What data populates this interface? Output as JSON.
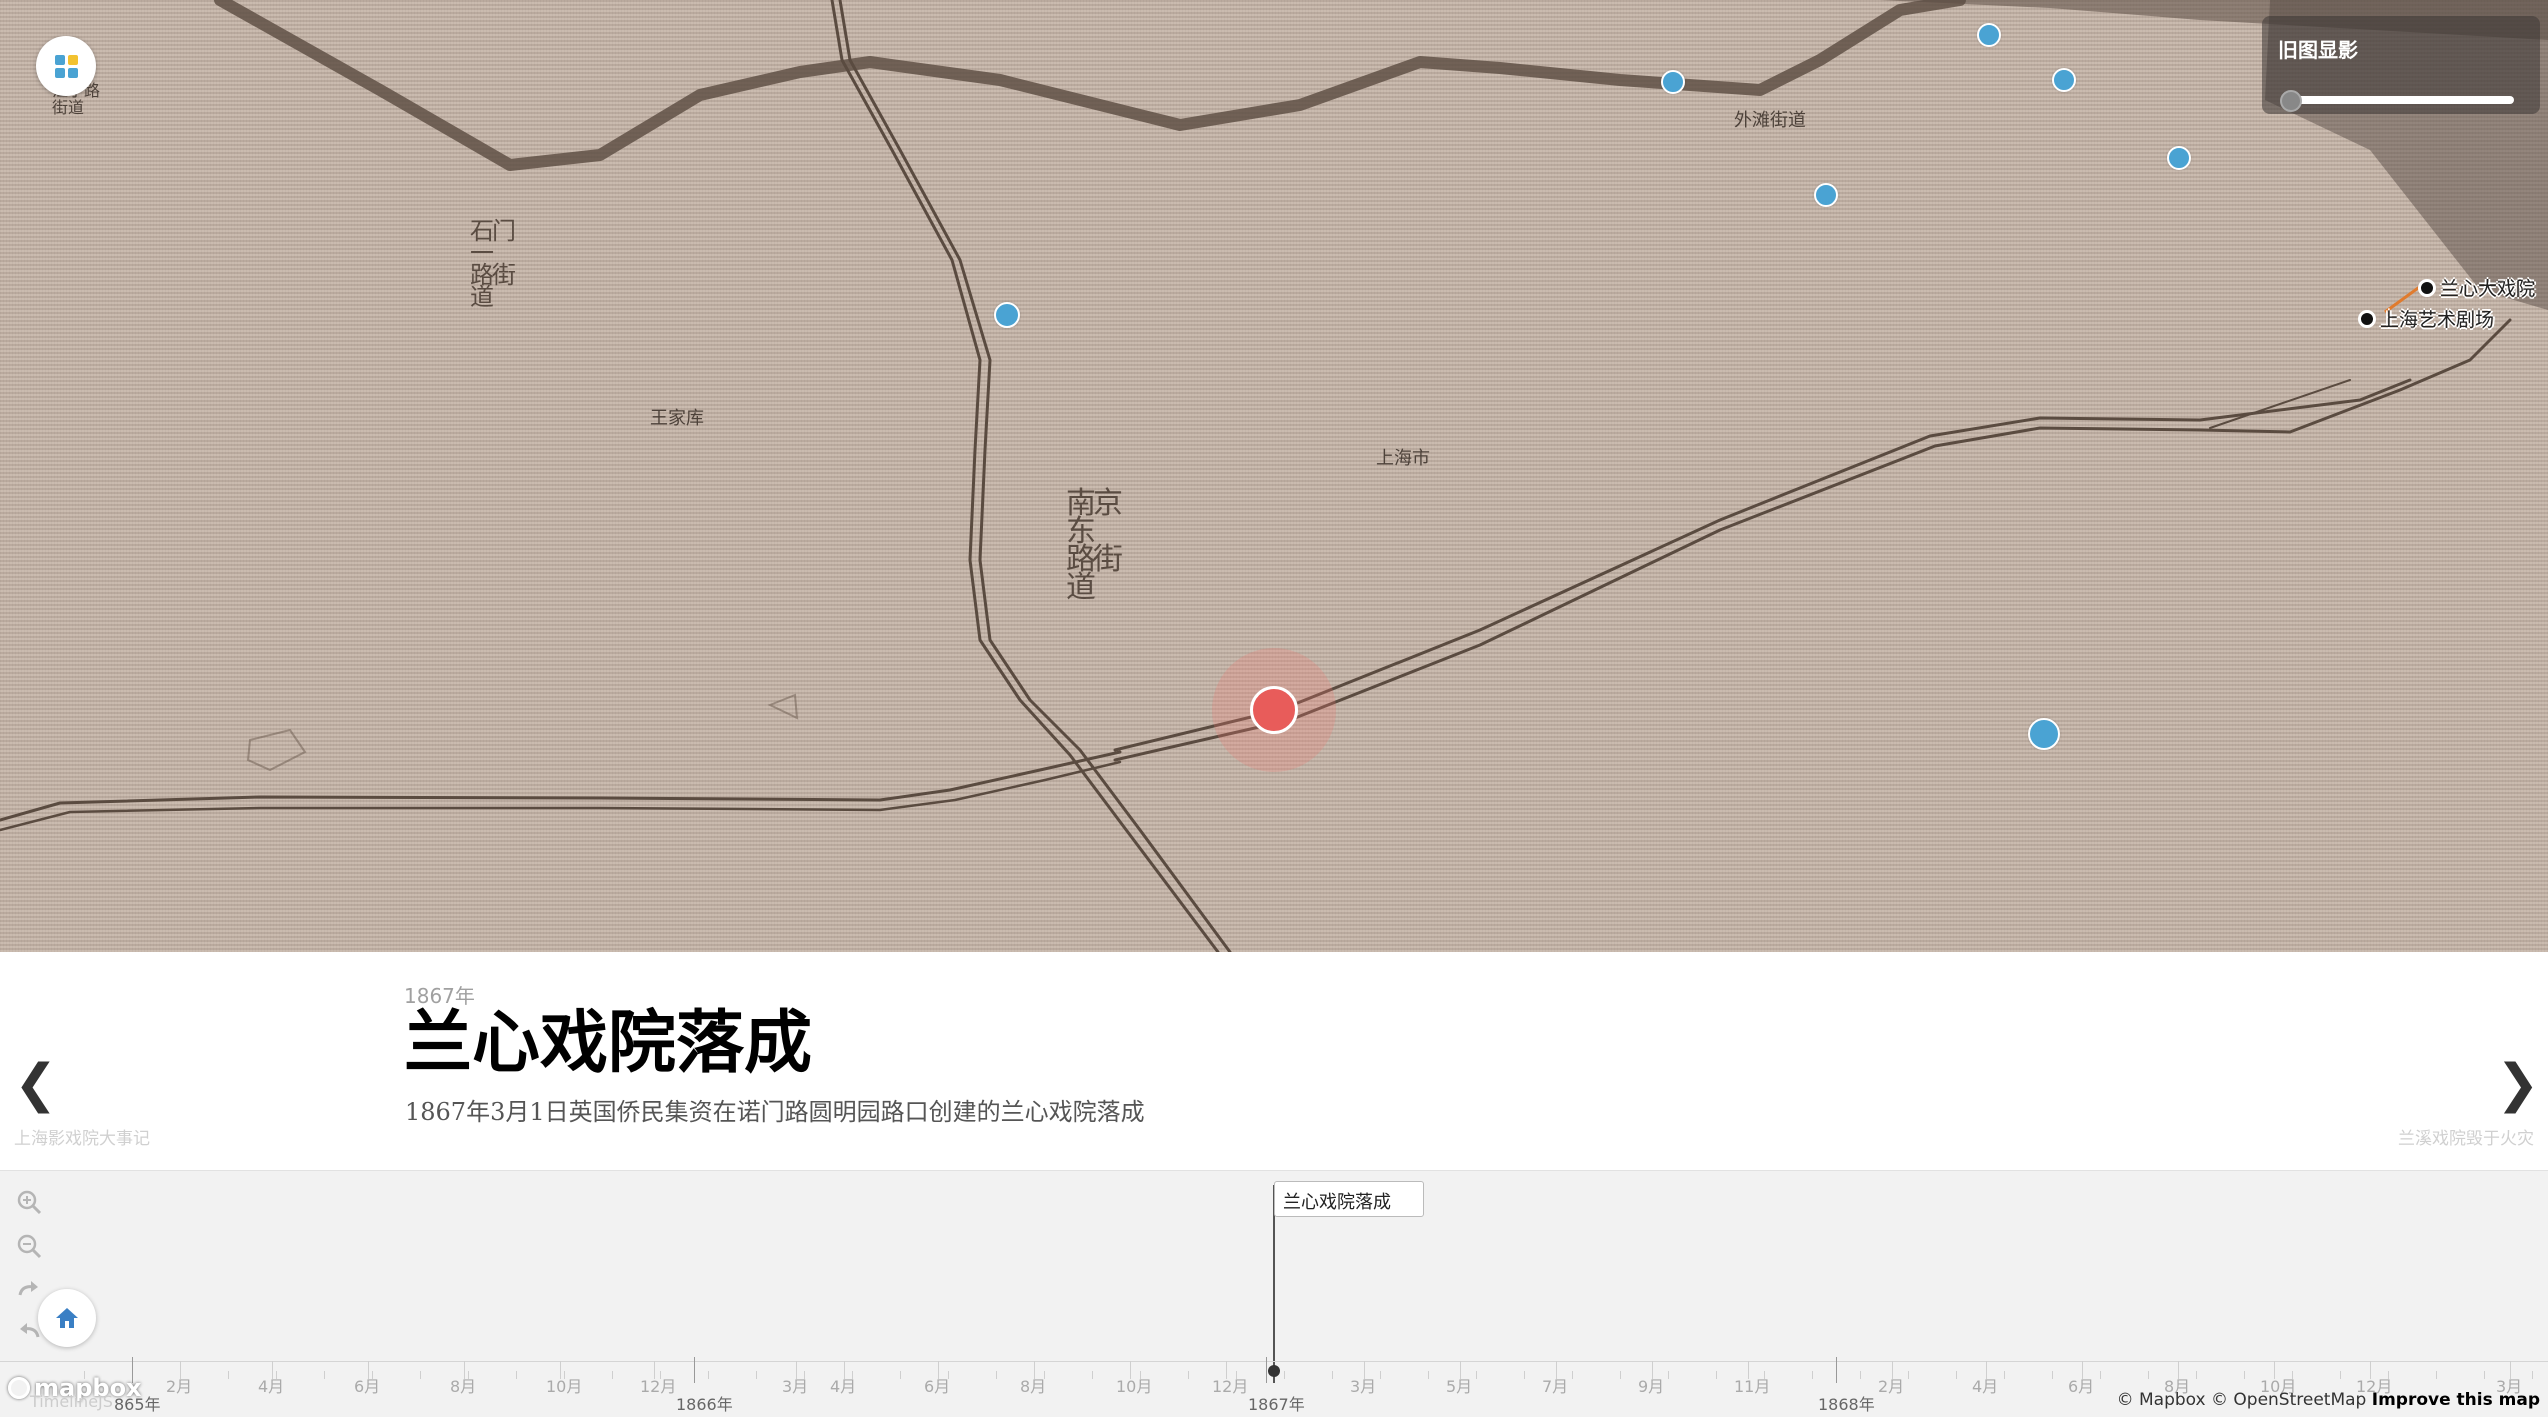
{
  "map": {
    "labels": [
      {
        "id": "lbl-waitan",
        "text": "外滩街道"
      },
      {
        "id": "lbl-shikumen",
        "text": "石门一\n路街道"
      },
      {
        "id": "lbl-wangjiaku",
        "text": "王家库"
      },
      {
        "id": "lbl-shanghai",
        "text": "上海市"
      },
      {
        "id": "lbl-nanjing",
        "text": "南京东\n路街道"
      },
      {
        "id": "lbl-topleft",
        "text": "江宁路\n街道"
      }
    ],
    "theatres": [
      {
        "name": "兰心大戏院"
      },
      {
        "name": "上海艺术剧场"
      }
    ],
    "overlay": {
      "title": "旧图显影",
      "opacity": 0.0
    }
  },
  "story": {
    "date": "1867年",
    "title": "兰心戏院落成",
    "description": "1867年3月1日英国侨民集资在诺门路圆明园路口创建的兰心戏院落成",
    "prev_arrow": "❮",
    "next_arrow": "❯",
    "prev_caption": "上海影戏院大事记",
    "next_caption": "兰溪戏院毁于火灾"
  },
  "timeline": {
    "flag_label": "兰心戏院落成",
    "month_labels": [
      "2月",
      "4月",
      "6月",
      "8月",
      "10月",
      "12月",
      "3月",
      "4月",
      "6月",
      "8月",
      "10月",
      "12月",
      "3月",
      "5月",
      "7月",
      "9月",
      "11月",
      "2月",
      "4月",
      "6月",
      "8月",
      "10月",
      "12月",
      "3月"
    ],
    "year_labels": [
      "865年",
      "1866年",
      "1867年",
      "1868年"
    ]
  },
  "footer": {
    "mapbox": "mapbox",
    "attribution_mapbox": "© Mapbox",
    "attribution_osm": "© OpenStreetMap",
    "improve": "Improve this map",
    "timeline_credit": "TimelineJS"
  },
  "colors": {
    "map_bg": "#c4b3a6",
    "poi": "#4aa3d3",
    "active": "#e85c5a",
    "road": "#5a4b40"
  }
}
